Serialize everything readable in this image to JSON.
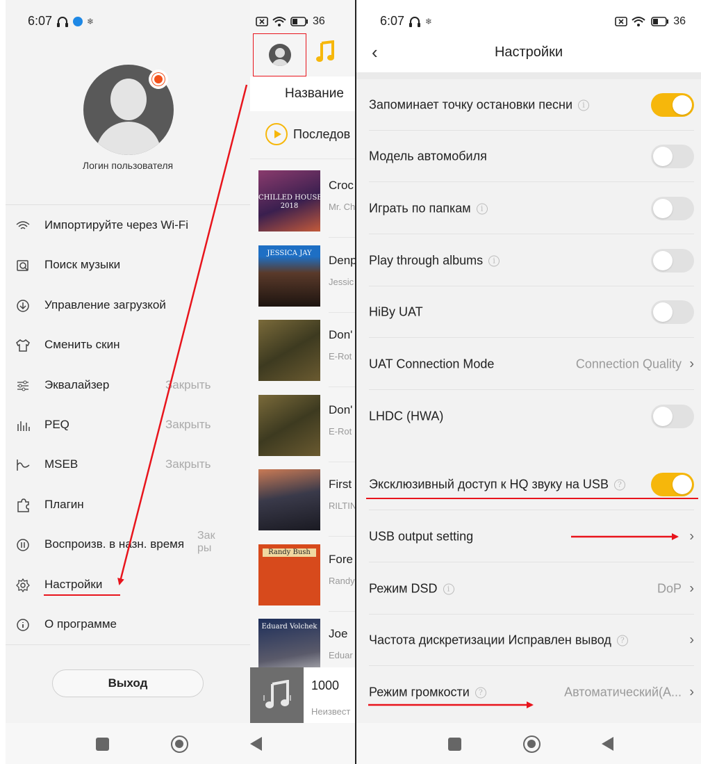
{
  "left": {
    "status": {
      "time": "6:07",
      "right_battery": "36"
    },
    "profile": {
      "username": "Логин пользователя"
    },
    "menu": [
      {
        "label": "Импортируйте через Wi-Fi",
        "icon": "wifi-icon",
        "value": ""
      },
      {
        "label": "Поиск музыки",
        "icon": "music-search-icon",
        "value": ""
      },
      {
        "label": "Управление загрузкой",
        "icon": "download-icon",
        "value": ""
      },
      {
        "label": "Сменить скин",
        "icon": "shirt-icon",
        "value": ""
      },
      {
        "label": "Эквалайзер",
        "icon": "equalizer-icon",
        "value": "Закрыть"
      },
      {
        "label": "PEQ",
        "icon": "peq-icon",
        "value": "Закрыть"
      },
      {
        "label": "MSEB",
        "icon": "mseb-icon",
        "value": "Закрыть"
      },
      {
        "label": "Плагин",
        "icon": "puzzle-icon",
        "value": ""
      },
      {
        "label": "Воспроизв. в назн. время",
        "icon": "timer-icon",
        "value": "Зак\nры"
      },
      {
        "label": "Настройки",
        "icon": "gear-icon",
        "value": ""
      },
      {
        "label": "О программе",
        "icon": "about-icon",
        "value": ""
      }
    ],
    "logout_label": "Выход",
    "songlist": {
      "header_title": "Название",
      "play_mode": "Последов",
      "songs": [
        {
          "title": "Croc",
          "artist": "Mr. Ch",
          "cover_text": "CHILLED HOUSE\n2018"
        },
        {
          "title": "Denp",
          "artist": "Jessic",
          "cover_text": "JESSICA JAY"
        },
        {
          "title": "Don'",
          "artist": "E-Rot",
          "cover_text": ""
        },
        {
          "title": "Don'",
          "artist": "E-Rot",
          "cover_text": ""
        },
        {
          "title": "First",
          "artist": "RILTIN",
          "cover_text": ""
        },
        {
          "title": "Fore",
          "artist": "Randy",
          "cover_text": "Randy Bush"
        },
        {
          "title": "Joe",
          "artist": "Eduar",
          "cover_text": "Eduard Volchek"
        }
      ],
      "now_playing": {
        "title": "1000",
        "artist": "Неизвест"
      }
    }
  },
  "right": {
    "status": {
      "time": "6:07",
      "battery": "36"
    },
    "title": "Настройки",
    "rows": [
      {
        "label": "Запоминает точку остановки песни",
        "info": true,
        "type": "toggle",
        "on": true
      },
      {
        "label": "Модель автомобиля",
        "info": false,
        "type": "toggle",
        "on": false
      },
      {
        "label": "Играть по папкам",
        "info": true,
        "type": "toggle",
        "on": false
      },
      {
        "label": "Play through albums",
        "info": true,
        "type": "toggle",
        "on": false
      },
      {
        "label": "HiBy UAT",
        "info": false,
        "type": "toggle",
        "on": false
      },
      {
        "label": "UAT Connection Mode",
        "info": false,
        "type": "value",
        "value": "Connection Quality"
      },
      {
        "label": "LHDC (HWA)",
        "info": false,
        "type": "toggle",
        "on": false
      },
      {
        "label": "Эксклюзивный доступ к HQ звуку на USB",
        "info": true,
        "type": "toggle",
        "on": true
      },
      {
        "label": "USB output setting",
        "info": false,
        "type": "chevron"
      },
      {
        "label": "Режим DSD",
        "info": true,
        "type": "value",
        "value": "DoP"
      },
      {
        "label": "Частота дискретизации Исправлен вывод",
        "info": true,
        "type": "chevron"
      },
      {
        "label": "Режим громкости",
        "info": true,
        "type": "value",
        "value": "Автоматический(А..."
      }
    ]
  },
  "colors": {
    "accent": "#f6b70b",
    "annotation": "#e8141c",
    "toggle_off": "#e1e1e1"
  }
}
